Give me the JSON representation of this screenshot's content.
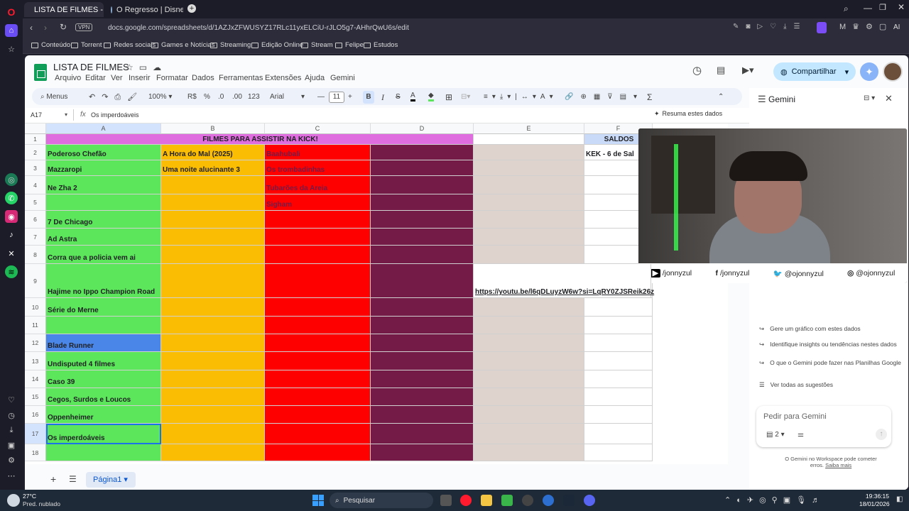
{
  "browser": {
    "tabs": [
      {
        "label": "LISTA DE FILMES - Google",
        "active": true
      },
      {
        "label": "O Regresso | Disney+",
        "active": false
      }
    ],
    "vpn_label": "VPN",
    "url": "docs.google.com/spreadsheets/d/1AZJxZFWUSYZ17RLc11yxELCiU-rJLO5g7-AHhrQwU6s/edit",
    "ai_label": "AI",
    "bookmarks": [
      "Conteúdo",
      "Torrent",
      "Redes sociais",
      "Games e Notícias",
      "Streaming",
      "Edição Online",
      "Stream",
      "Felipe",
      "Estudos"
    ]
  },
  "sheets": {
    "title": "LISTA DE FILMES",
    "menus": [
      "Arquivo",
      "Editar",
      "Ver",
      "Inserir",
      "Formatar",
      "Dados",
      "Ferramentas",
      "Extensões",
      "Ajuda",
      "Gemini"
    ],
    "share_label": "Compartilhar",
    "toolbar": {
      "menus_label": "Menus",
      "zoom": "100%",
      "currency": "R$",
      "percent": "%",
      "dec_less": ".0",
      "dec_more": ".00",
      "number_format": "123",
      "font": "Arial",
      "font_size": "11",
      "bold": "B",
      "italic": "I",
      "text_color": "A",
      "sum": "Σ"
    },
    "name_box": "A17",
    "formula_value": "Os imperdoáveis",
    "summarize_label": "Resuma estes dados",
    "columns": [
      "A",
      "B",
      "C",
      "D",
      "E",
      "F"
    ],
    "header_row": {
      "title": "FILMES PARA ASSISTIR NA KICK!",
      "saldos": "SALDOS"
    },
    "rows": [
      {
        "n": "2",
        "a": "Poderoso Chefão",
        "b": "A Hora do Mal (2025)",
        "c": "Baahubali",
        "f": "KEK - 6 de Sal"
      },
      {
        "n": "3",
        "a": "Mazzaropi",
        "b": "Uma noite alucinante 3",
        "c": "Os trombadinhas",
        "f": ""
      },
      {
        "n": "4",
        "a": "Ne Zha 2",
        "b": "",
        "c": "Tubarões da Areia",
        "f": ""
      },
      {
        "n": "5",
        "a": "",
        "b": "",
        "c": "Sigham",
        "f": ""
      },
      {
        "n": "6",
        "a": "7 De Chicago",
        "b": "",
        "c": "",
        "f": ""
      },
      {
        "n": "7",
        "a": "Ad Astra",
        "b": "",
        "c": "",
        "f": ""
      },
      {
        "n": "8",
        "a": "Corra que a policia vem ai",
        "b": "",
        "c": "",
        "f": ""
      },
      {
        "n": "9",
        "a": "Hajime no Ippo Champion Road",
        "b": "",
        "c": "",
        "e": "https://youtu.be/l6qDLuyzW6w?si=LqRY0ZJSReik26z",
        "f": ""
      },
      {
        "n": "10",
        "a": "Série do Merne",
        "b": "",
        "c": "",
        "f": ""
      },
      {
        "n": "11",
        "a": "",
        "b": "",
        "c": "",
        "f": ""
      },
      {
        "n": "12",
        "a": "Blade Runner",
        "b": "",
        "c": "",
        "f": ""
      },
      {
        "n": "13",
        "a": "Undisputed 4 filmes",
        "b": "",
        "c": "",
        "f": ""
      },
      {
        "n": "14",
        "a": "Caso 39",
        "b": "",
        "c": "",
        "f": ""
      },
      {
        "n": "15",
        "a": "Cegos, Surdos e Loucos",
        "b": "",
        "c": "",
        "f": ""
      },
      {
        "n": "16",
        "a": "Oppenheimer",
        "b": "",
        "c": "",
        "f": ""
      },
      {
        "n": "17",
        "a": "Os imperdoáveis",
        "b": "",
        "c": "",
        "f": ""
      },
      {
        "n": "18",
        "a": "",
        "b": "",
        "c": "",
        "f": ""
      }
    ],
    "sheet_tab": "Página1",
    "colors": {
      "green": "#5ce65c",
      "yellow": "#fbbc04",
      "red": "#ff0000",
      "wine": "#741b47",
      "taupe": "#dfd3cd",
      "blue": "#4a86e8",
      "pink": "#e06de0"
    }
  },
  "gemini": {
    "title": "Gemini",
    "suggestions": [
      "Gere um gráfico com estes dados",
      "Identifique insights ou tendências nestes dados",
      "O que o Gemini pode fazer nas Planilhas Google",
      "Ver todas as sugestões"
    ],
    "input_placeholder": "Pedir para Gemini",
    "attach_count": "2",
    "disclaimer": "O Gemini no Workspace pode cometer erros.",
    "learn_more": "Saiba mais"
  },
  "webcam": {
    "socials": [
      "/jonnyzul",
      "/jonnyzul",
      "@ojonnyzul",
      "@ojonnyzul"
    ]
  },
  "taskbar": {
    "temperature": "27°C",
    "weather": "Pred. nublado",
    "search_label": "Pesquisar",
    "time": "19:36:15",
    "date": "18/01/2026"
  }
}
